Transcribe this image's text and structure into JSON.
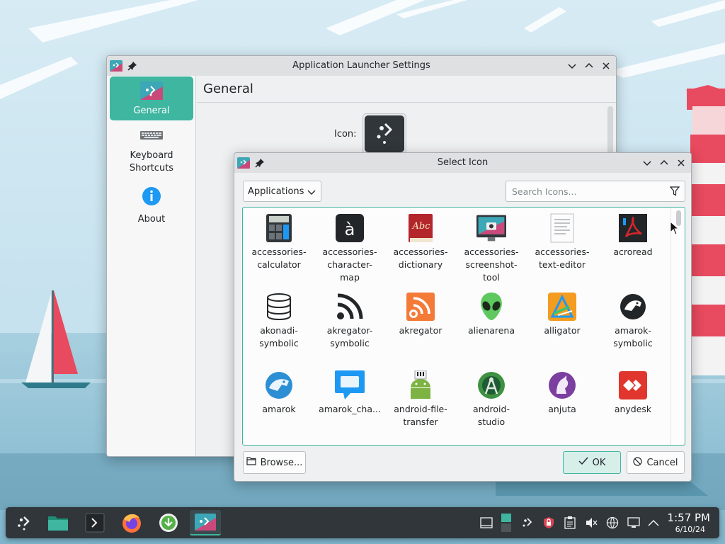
{
  "colors": {
    "accent": "#3eb6a0",
    "window_bg": "#eff0f1",
    "titlebar_bg": "#dee0e2",
    "panel_bg": "#30363a",
    "sky": "#cfe6f2"
  },
  "settings_window": {
    "title": "Application Launcher Settings",
    "sidebar": [
      {
        "label": "General",
        "icon": "launcher-settings-icon",
        "active": true
      },
      {
        "label": "Keyboard Shortcuts",
        "icon": "keyboard-icon",
        "active": false
      },
      {
        "label": "About",
        "icon": "info-icon",
        "active": false
      }
    ],
    "header": "General",
    "icon_label": "Icon:"
  },
  "dialog": {
    "title": "Select Icon",
    "filter": {
      "selected": "Applications"
    },
    "search": {
      "placeholder": "Search Icons..."
    },
    "icons": [
      {
        "name": "accessories-calculator",
        "label": "accessories-\ncalculator",
        "icon": "calculator-icon"
      },
      {
        "name": "accessories-character-map",
        "label": "accessories-\ncharacter-\nmap",
        "icon": "character-map-icon"
      },
      {
        "name": "accessories-dictionary",
        "label": "accessories-\ndictionary",
        "icon": "dictionary-icon"
      },
      {
        "name": "accessories-screenshot-tool",
        "label": "accessories-\nscreenshot-\ntool",
        "icon": "screenshot-icon"
      },
      {
        "name": "accessories-text-editor",
        "label": "accessories-\ntext-editor",
        "icon": "text-editor-icon"
      },
      {
        "name": "acroread",
        "label": "acroread",
        "icon": "acroread-icon"
      },
      {
        "name": "akonadi-symbolic",
        "label": "akonadi-\nsymbolic",
        "icon": "database-icon"
      },
      {
        "name": "akregator-symbolic",
        "label": "akregator-\nsymbolic",
        "icon": "rss-symbolic-icon"
      },
      {
        "name": "akregator",
        "label": "akregator",
        "icon": "rss-icon"
      },
      {
        "name": "alienarena",
        "label": "alienarena",
        "icon": "alien-icon"
      },
      {
        "name": "alligator",
        "label": "alligator",
        "icon": "alligator-icon"
      },
      {
        "name": "amarok-symbolic",
        "label": "amarok-\nsymbolic",
        "icon": "amarok-symbolic-icon"
      },
      {
        "name": "amarok",
        "label": "amarok",
        "icon": "amarok-icon"
      },
      {
        "name": "amarok_cha",
        "label": "amarok_cha...",
        "icon": "chat-bubble-icon"
      },
      {
        "name": "android-file-transfer",
        "label": "android-file-\ntransfer",
        "icon": "android-file-transfer-icon"
      },
      {
        "name": "android-studio",
        "label": "android-\nstudio",
        "icon": "android-studio-icon"
      },
      {
        "name": "anjuta",
        "label": "anjuta",
        "icon": "anjuta-icon"
      },
      {
        "name": "anydesk",
        "label": "anydesk",
        "icon": "anydesk-icon"
      }
    ],
    "buttons": {
      "browse": "Browse...",
      "ok": "OK",
      "cancel": "Cancel"
    }
  },
  "taskbar": {
    "launchers": [
      {
        "name": "app-launcher",
        "icon": "kde-launcher-icon"
      },
      {
        "name": "dolphin",
        "icon": "folder-icon"
      },
      {
        "name": "konsole",
        "icon": "terminal-icon"
      },
      {
        "name": "firefox",
        "icon": "firefox-icon"
      },
      {
        "name": "discover",
        "icon": "download-icon"
      },
      {
        "name": "settings-window",
        "icon": "launcher-settings-icon"
      }
    ],
    "tray": [
      "show-desktop-icon",
      "pager-icon",
      "kdeconnect-icon",
      "vault-icon",
      "clipboard-icon",
      "volume-muted-icon",
      "network-icon",
      "display-icon",
      "expand-tray-icon"
    ],
    "clock": {
      "time": "1:57 PM",
      "date": "6/10/24"
    }
  }
}
